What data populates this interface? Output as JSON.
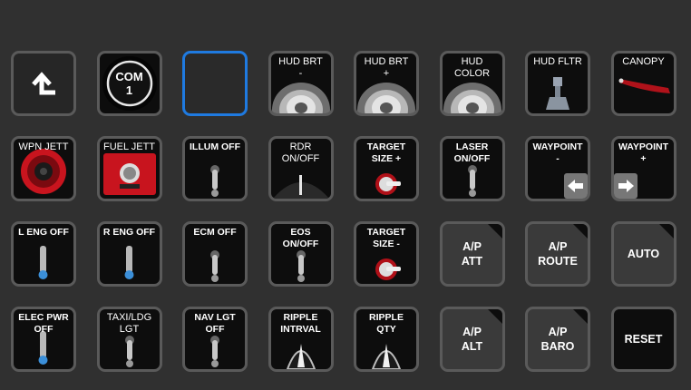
{
  "rows": [
    [
      {
        "id": "back",
        "label": "",
        "icon": "back-arrow-icon",
        "style": "back"
      },
      {
        "id": "com1",
        "label": "COM\n1",
        "icon": "com-knob-icon",
        "style": "knob"
      },
      {
        "id": "empty",
        "label": "",
        "icon": "",
        "style": "empty"
      },
      {
        "id": "hud-brt-minus",
        "label": "HUD BRT\n-",
        "icon": "rotary-knob-icon",
        "style": "plain"
      },
      {
        "id": "hud-brt-plus",
        "label": "HUD BRT\n+",
        "icon": "rotary-knob-icon",
        "style": "plain"
      },
      {
        "id": "hud-color",
        "label": "HUD\nCOLOR",
        "icon": "rotary-knob-icon",
        "style": "plain"
      },
      {
        "id": "hud-fltr",
        "label": "HUD FLTR",
        "icon": "filter-lever-icon",
        "style": "plain"
      },
      {
        "id": "canopy",
        "label": "CANOPY",
        "icon": "canopy-handle-icon",
        "style": "plain"
      }
    ],
    [
      {
        "id": "wpn-jett",
        "label": "WPN JETT",
        "icon": "red-jettison-knob-icon",
        "style": "plain"
      },
      {
        "id": "fuel-jett",
        "label": "FUEL JETT",
        "icon": "red-fuel-jettison-icon",
        "style": "plain"
      },
      {
        "id": "illum-off",
        "label": "ILLUM OFF",
        "icon": "toggle-switch-icon",
        "style": "bold"
      },
      {
        "id": "rdr-onoff",
        "label": "RDR\nON/OFF",
        "icon": "rdr-knob-icon",
        "style": "plain"
      },
      {
        "id": "target-size-plus",
        "label": "TARGET\nSIZE +",
        "icon": "rotary-switch-icon",
        "style": "bold"
      },
      {
        "id": "laser-onoff",
        "label": "LASER\nON/OFF",
        "icon": "toggle-switch-icon",
        "style": "bold"
      },
      {
        "id": "waypoint-minus",
        "label": "WAYPOINT\n-",
        "icon": "left-arrow-icon",
        "style": "bold"
      },
      {
        "id": "waypoint-plus",
        "label": "WAYPOINT\n+",
        "icon": "right-arrow-icon",
        "style": "bold"
      }
    ],
    [
      {
        "id": "l-eng-off",
        "label": "L ENG OFF",
        "icon": "blue-toggle-icon",
        "style": "bold"
      },
      {
        "id": "r-eng-off",
        "label": "R ENG OFF",
        "icon": "blue-toggle-icon",
        "style": "bold"
      },
      {
        "id": "ecm-off",
        "label": "ECM OFF",
        "icon": "toggle-switch-icon",
        "style": "bold"
      },
      {
        "id": "eos-onoff",
        "label": "EOS\nON/OFF",
        "icon": "toggle-switch-icon",
        "style": "bold"
      },
      {
        "id": "target-size-minus",
        "label": "TARGET\nSIZE -",
        "icon": "rotary-switch-icon",
        "style": "bold"
      },
      {
        "id": "ap-att",
        "label": "A/P\nATT",
        "icon": "",
        "style": "ap"
      },
      {
        "id": "ap-route",
        "label": "A/P\nROUTE",
        "icon": "",
        "style": "ap"
      },
      {
        "id": "auto",
        "label": "AUTO",
        "icon": "",
        "style": "ap"
      }
    ],
    [
      {
        "id": "elec-pwr-off",
        "label": "ELEC PWR\nOFF",
        "icon": "blue-toggle-icon",
        "style": "bold"
      },
      {
        "id": "taxi-ldg-lgt",
        "label": "TAXI/LDG\nLGT",
        "icon": "toggle-switch-icon",
        "style": "plain"
      },
      {
        "id": "nav-lgt-off",
        "label": "NAV LGT\nOFF",
        "icon": "toggle-switch-icon",
        "style": "bold"
      },
      {
        "id": "ripple-intrval",
        "label": "RIPPLE\nINTRVAL",
        "icon": "pointer-knob-icon",
        "style": "bold"
      },
      {
        "id": "ripple-qty",
        "label": "RIPPLE\nQTY",
        "icon": "pointer-knob-icon",
        "style": "bold"
      },
      {
        "id": "ap-alt",
        "label": "A/P\nALT",
        "icon": "",
        "style": "ap"
      },
      {
        "id": "ap-baro",
        "label": "A/P\nBARO",
        "icon": "",
        "style": "ap"
      },
      {
        "id": "reset",
        "label": "RESET",
        "icon": "",
        "style": "reset"
      }
    ]
  ],
  "colors": {
    "background": "#303030",
    "button": "#0d0d0d",
    "border": "#5a5a5a",
    "selected": "#1f7ae0",
    "jettison": "#c8141e",
    "eng_tip": "#3b8fd9"
  }
}
